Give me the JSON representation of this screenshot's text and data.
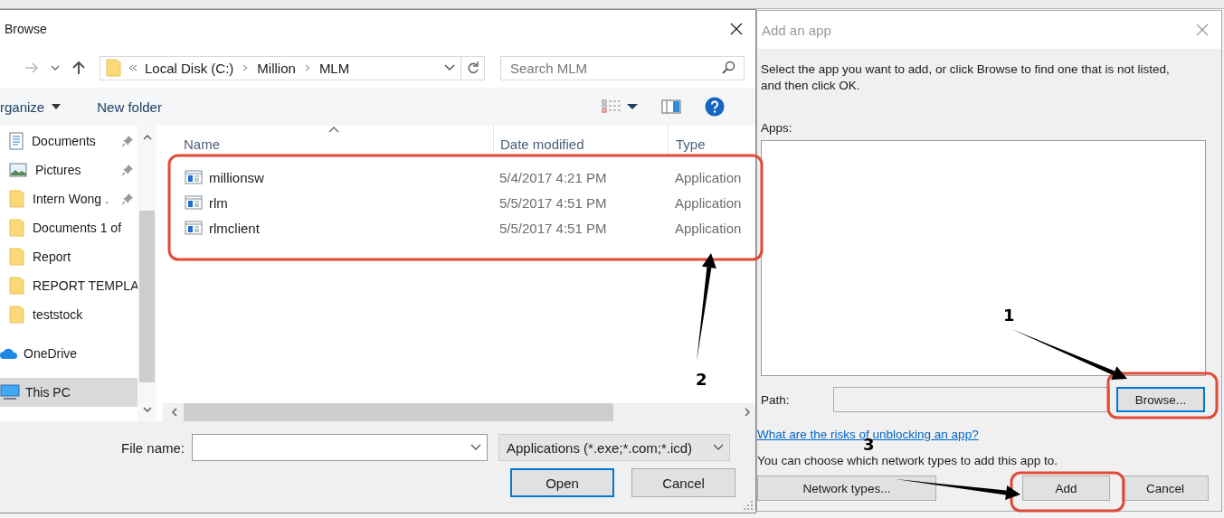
{
  "browse_dialog": {
    "title": "Browse",
    "active": true,
    "address": {
      "segments": [
        "Local Disk (C:)",
        "Million",
        "MLM"
      ]
    },
    "search": {
      "placeholder": "Search MLM"
    },
    "toolbar": {
      "organize": "rganize",
      "new_folder": "New folder"
    },
    "sidebar": {
      "items": [
        {
          "label": "Documents",
          "kind": "documents",
          "pinned": true,
          "selected": false
        },
        {
          "label": "Pictures",
          "kind": "pictures",
          "pinned": true,
          "selected": false
        },
        {
          "label": "Intern Wong .",
          "kind": "folder",
          "pinned": true,
          "selected": false
        },
        {
          "label": "Documents 1 of",
          "kind": "folder",
          "pinned": false,
          "selected": false
        },
        {
          "label": "Report",
          "kind": "folder",
          "pinned": false,
          "selected": false
        },
        {
          "label": "REPORT TEMPLA",
          "kind": "folder",
          "pinned": false,
          "selected": false
        },
        {
          "label": "teststock",
          "kind": "folder",
          "pinned": false,
          "selected": false
        },
        {
          "label": "OneDrive",
          "kind": "cloud",
          "pinned": false,
          "selected": false
        },
        {
          "label": "This PC",
          "kind": "computer",
          "pinned": false,
          "selected": true
        }
      ]
    },
    "files": {
      "columns": [
        {
          "label": "Name",
          "sorted": true
        },
        {
          "label": "Date modified",
          "sorted": false
        },
        {
          "label": "Type",
          "sorted": false
        }
      ],
      "rows": [
        {
          "name": "millionsw",
          "date": "5/4/2017 4:21 PM",
          "type": "Application"
        },
        {
          "name": "rlm",
          "date": "5/5/2017 4:51 PM",
          "type": "Application"
        },
        {
          "name": "rlmclient",
          "date": "5/5/2017 4:51 PM",
          "type": "Application"
        }
      ]
    },
    "file_name": {
      "label": "File name:"
    },
    "file_type": "Applications (*.exe;*.com;*.icd)",
    "buttons": [
      {
        "label": "Open",
        "default": true
      },
      {
        "label": "Cancel",
        "default": false
      }
    ]
  },
  "add_app_dialog": {
    "title": "Add an app",
    "active": false,
    "instructions": "Select the app you want to add, or click Browse to find one that is not listed, and then click OK.",
    "apps_label": "Apps:",
    "path_label": "Path:",
    "browse_button": {
      "label": "Browse...",
      "default": true
    },
    "link": "What are the risks of unblocking an app?",
    "network_note": "You can choose which network types to add this app to.",
    "buttons": [
      {
        "label": "Network types...",
        "default": false
      },
      {
        "label": "Add",
        "default": false
      },
      {
        "label": "Cancel",
        "default": false
      }
    ]
  },
  "annotations": [
    {
      "label": "1"
    },
    {
      "label": "2"
    },
    {
      "label": "3"
    }
  ]
}
